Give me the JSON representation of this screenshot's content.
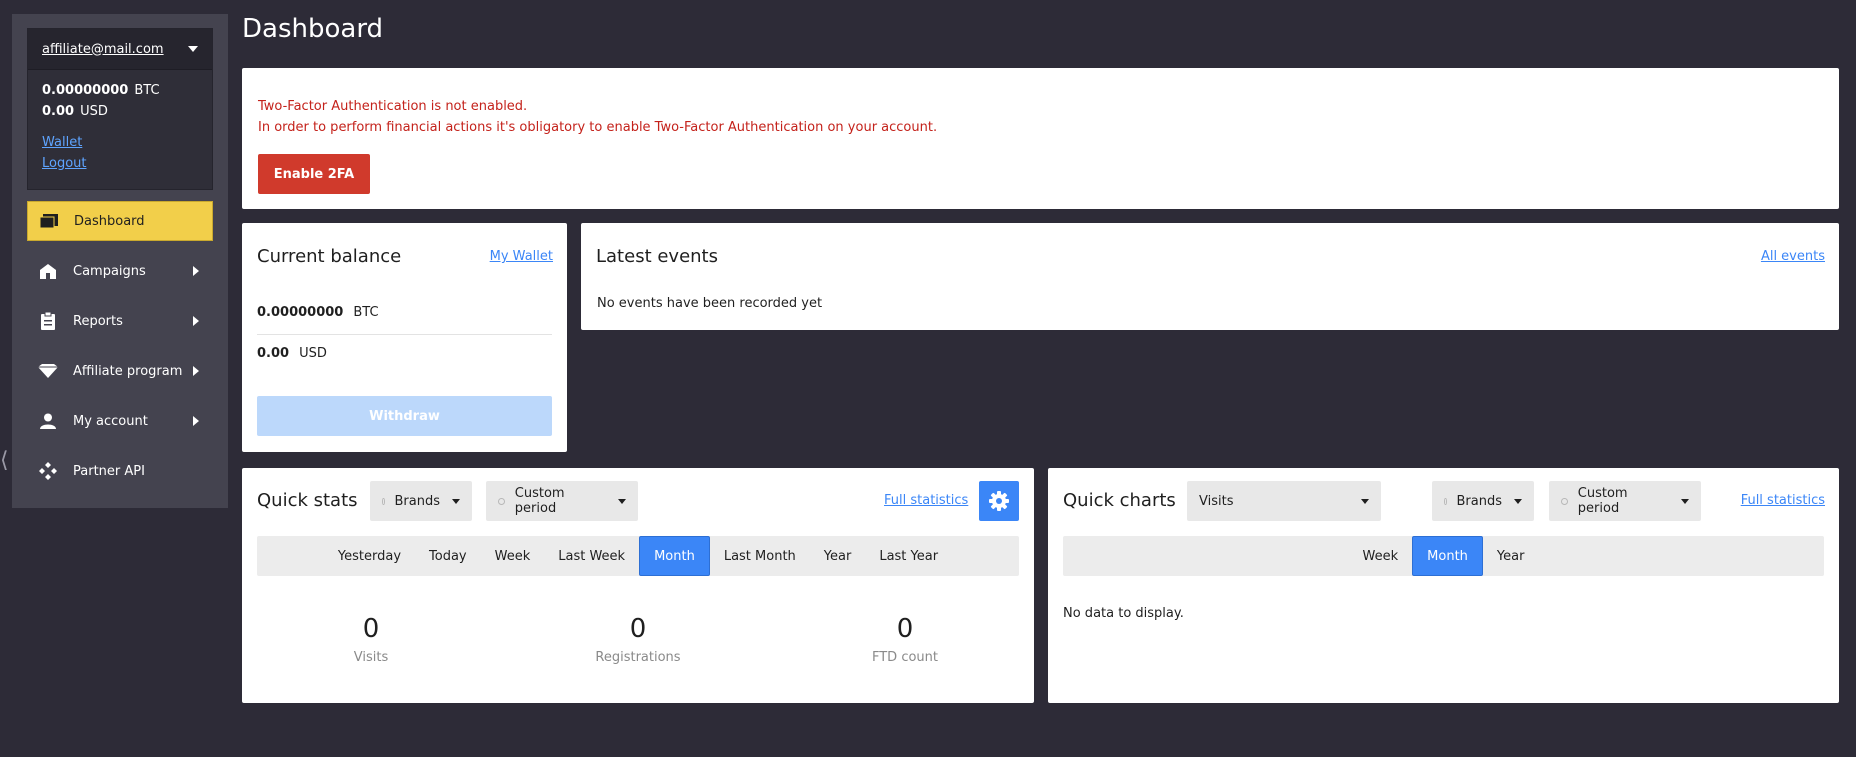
{
  "account": {
    "email": "affiliate@mail.com",
    "btc_value": "0.00000000",
    "btc_unit": "BTC",
    "usd_value": "0.00",
    "usd_unit": "USD",
    "wallet_link": "Wallet",
    "logout_link": "Logout"
  },
  "sidebar": {
    "items": [
      {
        "label": "Dashboard",
        "icon": "dashboard-icon",
        "active": true
      },
      {
        "label": "Campaigns",
        "icon": "home-icon"
      },
      {
        "label": "Reports",
        "icon": "clipboard-icon"
      },
      {
        "label": "Affiliate program",
        "icon": "diamond-icon"
      },
      {
        "label": "My account",
        "icon": "user-icon"
      },
      {
        "label": "Partner API",
        "icon": "api-icon"
      }
    ]
  },
  "page": {
    "title": "Dashboard"
  },
  "alert": {
    "line1": "Two-Factor Authentication is not enabled.",
    "line2": "In order to perform financial actions it's obligatory to enable Two-Factor Authentication on your account.",
    "button": "Enable 2FA"
  },
  "balance": {
    "title": "Current balance",
    "link": "My Wallet",
    "btc_value": "0.00000000",
    "btc_unit": "BTC",
    "usd_value": "0.00",
    "usd_unit": "USD",
    "withdraw": "Withdraw"
  },
  "events": {
    "title": "Latest events",
    "link": "All events",
    "empty": "No events have been recorded yet"
  },
  "quick_stats": {
    "title": "Quick stats",
    "brands": "Brands",
    "period": "Custom period",
    "full_link": "Full statistics",
    "tabs": [
      "Yesterday",
      "Today",
      "Week",
      "Last Week",
      "Month",
      "Last Month",
      "Year",
      "Last Year"
    ],
    "active_tab": "Month",
    "stats": [
      {
        "value": "0",
        "label": "Visits"
      },
      {
        "value": "0",
        "label": "Registrations"
      },
      {
        "value": "0",
        "label": "FTD count"
      }
    ]
  },
  "quick_charts": {
    "title": "Quick charts",
    "metric": "Visits",
    "brands": "Brands",
    "period": "Custom period",
    "full_link": "Full statistics",
    "tabs": [
      "Week",
      "Month",
      "Year"
    ],
    "active_tab": "Month",
    "empty": "No data to display."
  },
  "colors": {
    "accent": "#3b86f7",
    "active_nav": "#f2cf4a",
    "alert": "#c4221b",
    "danger_button": "#d03a2c"
  }
}
